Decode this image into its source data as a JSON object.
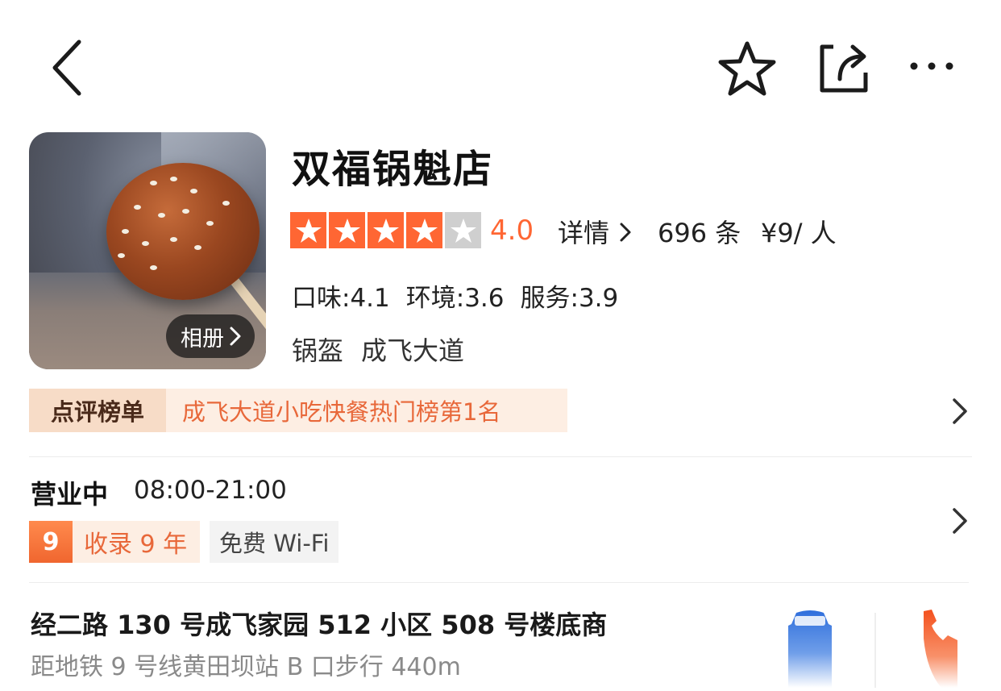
{
  "toolbar": {
    "back_icon": "chevron-left-icon",
    "favorite_icon": "star-outline-icon",
    "share_icon": "share-icon",
    "more_icon": "more-dots-icon"
  },
  "shop": {
    "name": "双福锅魁店",
    "album_label": "相册",
    "rating_stars": 4,
    "rating": "4.0",
    "detail_link": "详情",
    "review_count": "696 条",
    "price": "¥9/ 人",
    "scores": [
      {
        "label": "口味:4.1"
      },
      {
        "label": "环境:3.6"
      },
      {
        "label": "服务:3.9"
      }
    ],
    "tags": [
      "锅盔",
      "成飞大道"
    ]
  },
  "ranking": {
    "label": "点评榜单",
    "text": "成飞大道小吃快餐热门榜第1名"
  },
  "hours": {
    "status": "营业中",
    "time": "08:00-21:00",
    "years_num": "9",
    "years_text": "收录 9 年",
    "wifi": "免费 Wi-Fi"
  },
  "address": {
    "line": "经二路 130 号成飞家园 512 小区 508 号楼底商",
    "metro": "距地铁 9 号线黄田坝站 B 口步行 440m",
    "car_icon": "car-icon",
    "phone_icon": "phone-icon"
  },
  "colors": {
    "accent": "#ff6633",
    "rank_bg": "#fdeee3",
    "car_blue": "#3c79e0"
  }
}
